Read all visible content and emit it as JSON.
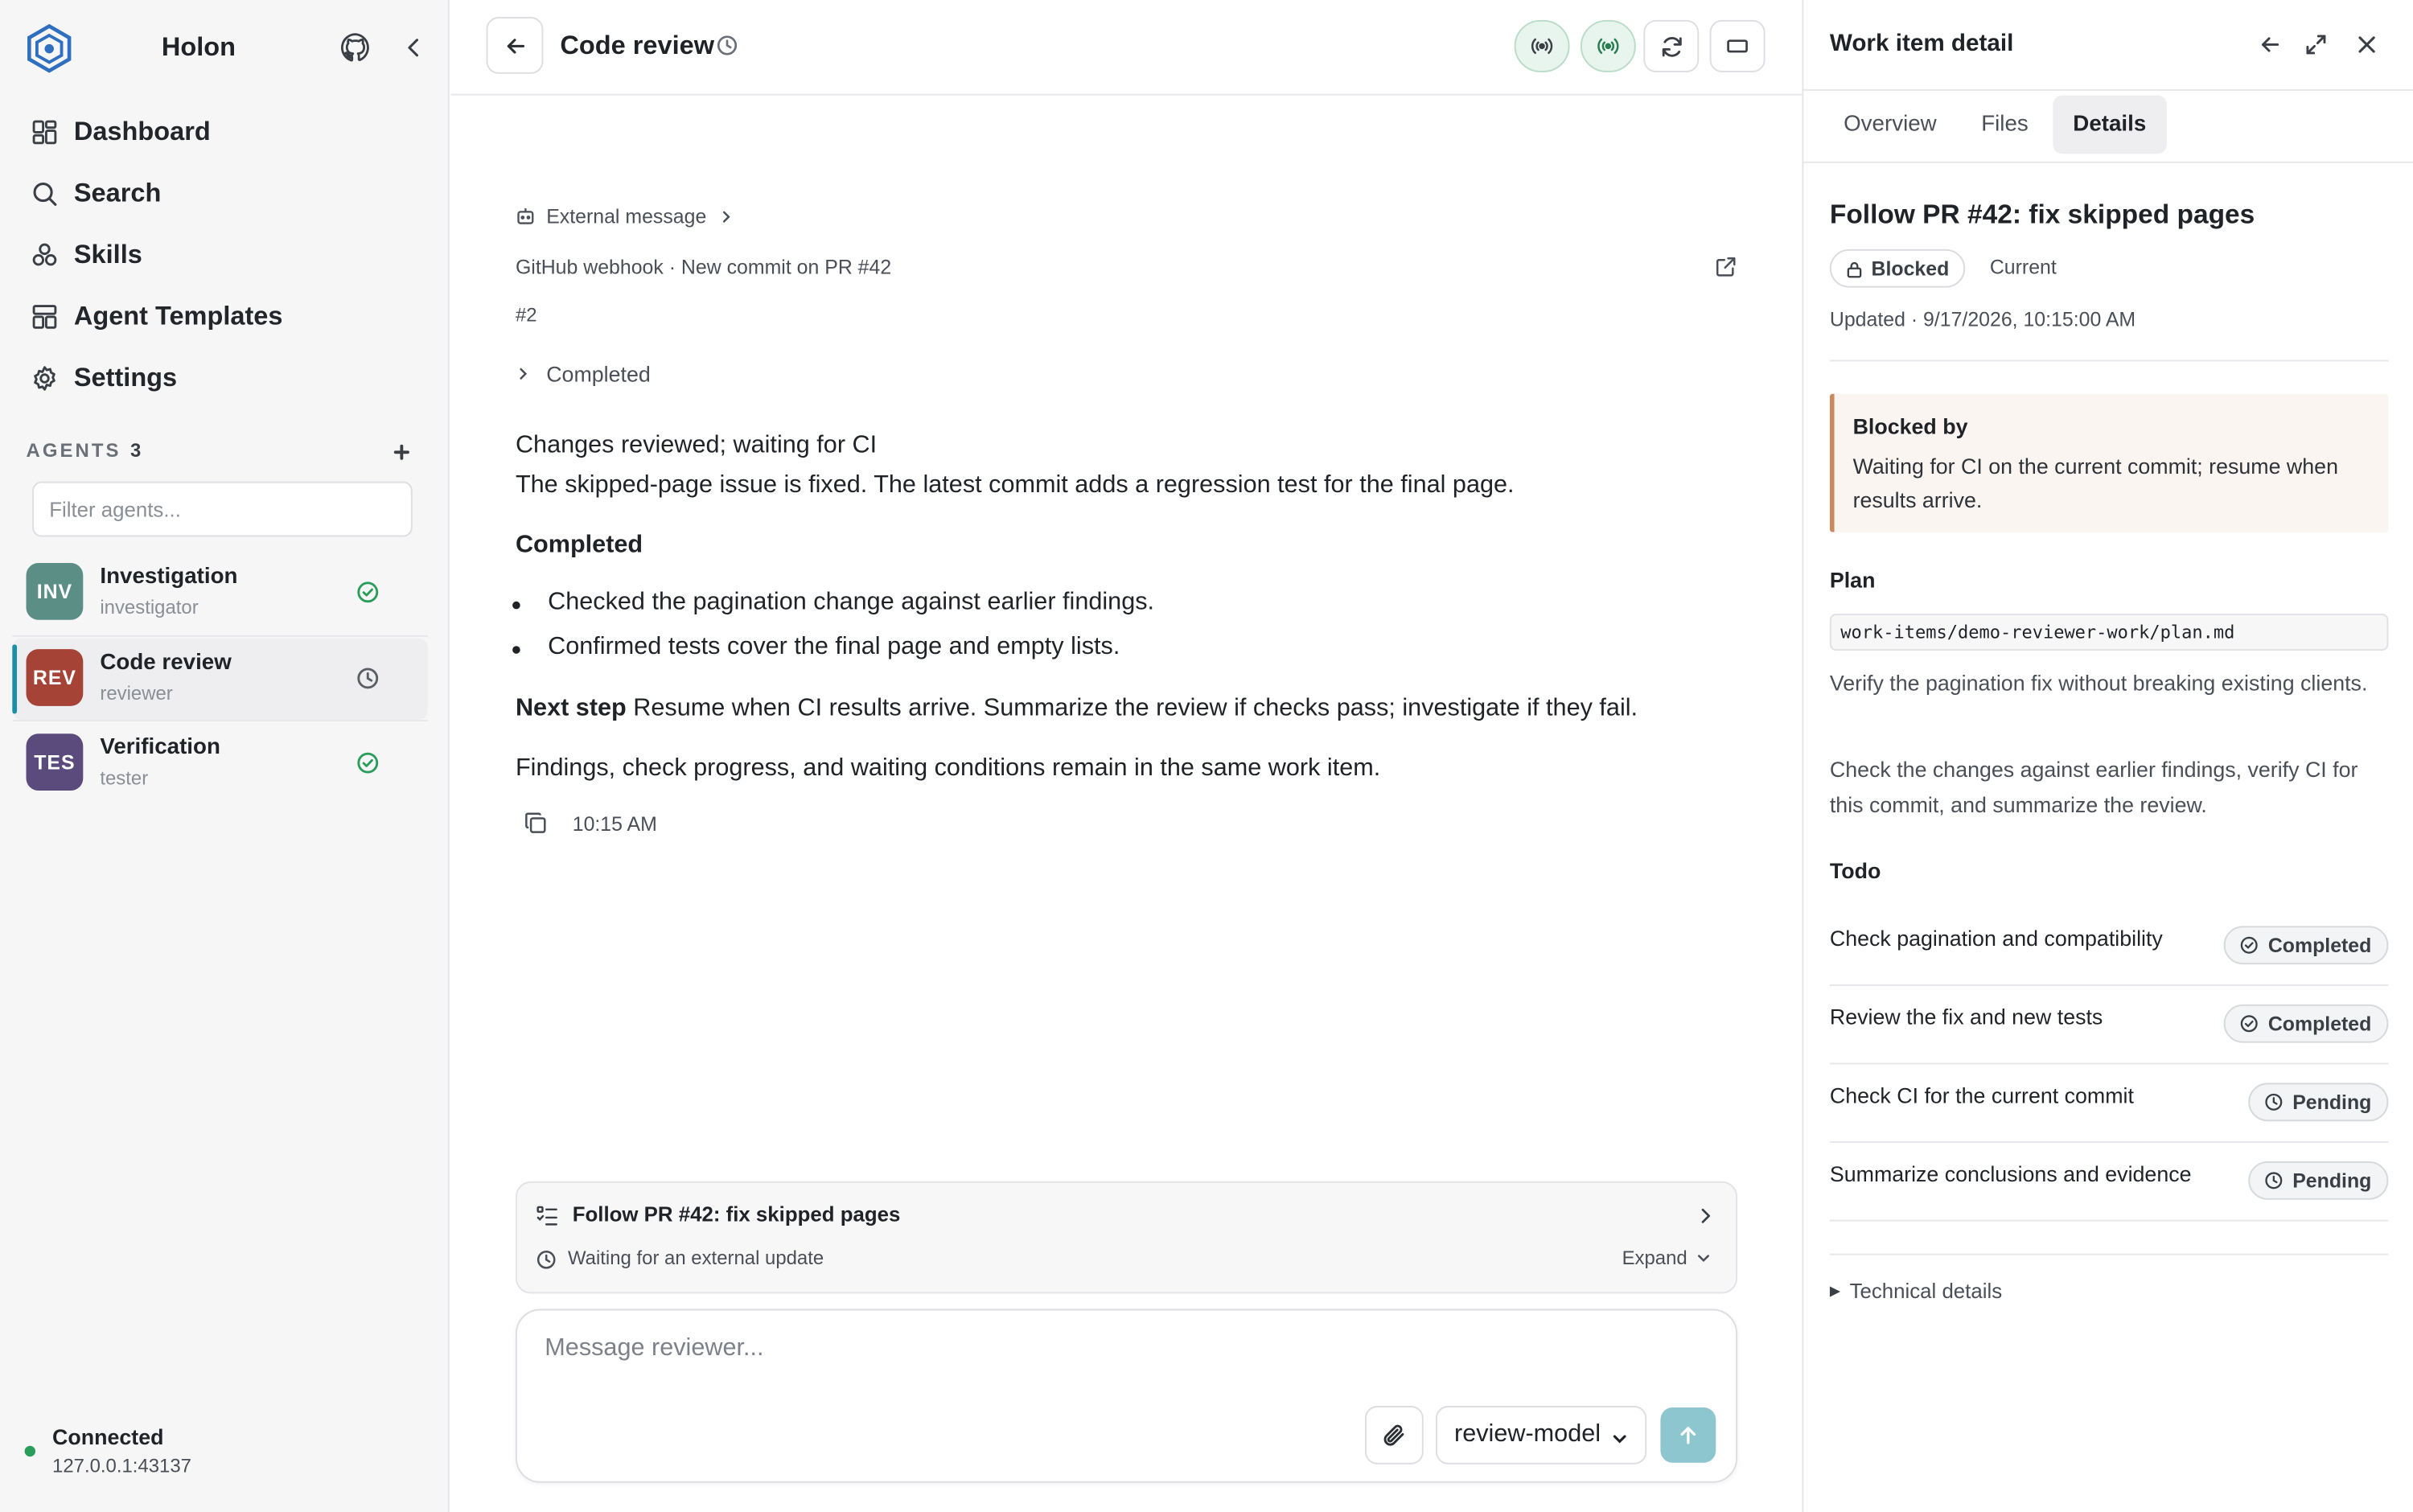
{
  "app": {
    "name": "Holon"
  },
  "sidebar": {
    "nav": [
      {
        "label": "Dashboard",
        "icon": "dashboard-icon"
      },
      {
        "label": "Search",
        "icon": "search-icon"
      },
      {
        "label": "Skills",
        "icon": "skills-icon"
      },
      {
        "label": "Agent Templates",
        "icon": "templates-icon"
      },
      {
        "label": "Settings",
        "icon": "gear-icon"
      }
    ],
    "agents_label": "AGENTS",
    "agents_count": "3",
    "filter_placeholder": "Filter agents...",
    "agents": [
      {
        "initials": "INV",
        "name": "Investigation",
        "role": "investigator",
        "status": "completed",
        "color": "#5b8f86"
      },
      {
        "initials": "REV",
        "name": "Code review",
        "role": "reviewer",
        "status": "waiting",
        "color": "#a54336"
      },
      {
        "initials": "TES",
        "name": "Verification",
        "role": "tester",
        "status": "completed",
        "color": "#5b4a7c"
      }
    ],
    "connection": {
      "status": "Connected",
      "address": "127.0.0.1:43137",
      "color": "#2a9d5b"
    }
  },
  "main": {
    "title": "Code review",
    "message": {
      "source": "External message",
      "meta": "GitHub webhook · New commit on PR #42",
      "number": "#2",
      "completed_toggle": "Completed",
      "headline": "Changes reviewed; waiting for CI",
      "summary": "The skipped-page issue is fixed. The latest commit adds a regression test for the final page.",
      "section_title": "Completed",
      "bullets": [
        "Checked the pagination change against earlier findings.",
        "Confirmed tests cover the final page and empty lists."
      ],
      "next_step_label": "Next step",
      "next_step_text": "Resume when CI results arrive. Summarize the review if checks pass; investigate if they fail.",
      "closing": "Findings, check progress, and waiting conditions remain in the same work item.",
      "time": "10:15 AM"
    },
    "task_card": {
      "title": "Follow PR #42: fix skipped pages",
      "status": "Waiting for an external update",
      "expand": "Expand"
    },
    "composer": {
      "placeholder": "Message reviewer...",
      "model": "review-model"
    }
  },
  "panel": {
    "title": "Work item detail",
    "tabs": [
      "Overview",
      "Files",
      "Details"
    ],
    "active_tab": "Details",
    "work_item": {
      "title": "Follow PR #42: fix skipped pages",
      "state": "Blocked",
      "version": "Current",
      "updated": "Updated · 9/17/2026, 10:15:00 AM"
    },
    "blocked": {
      "title": "Blocked by",
      "text": "Waiting for CI on the current commit; resume when results arrive."
    },
    "plan": {
      "label": "Plan",
      "path": "work-items/demo-reviewer-work/plan.md",
      "goal": "Verify the pagination fix without breaking existing clients.",
      "approach": "Check the changes against earlier findings, verify CI for this commit, and summarize the review."
    },
    "todo": {
      "label": "Todo",
      "items": [
        {
          "label": "Check pagination and compatibility",
          "status": "Completed"
        },
        {
          "label": "Review the fix and new tests",
          "status": "Completed"
        },
        {
          "label": "Check CI for the current commit",
          "status": "Pending"
        },
        {
          "label": "Summarize conclusions and evidence",
          "status": "Pending"
        }
      ]
    },
    "technical_details": "Technical details"
  },
  "colors": {
    "accent": "#1b8fa6",
    "send_button": "#8ec6d0",
    "blocked_border": "#c9885e",
    "live_indicator": "#2a9d5b"
  }
}
